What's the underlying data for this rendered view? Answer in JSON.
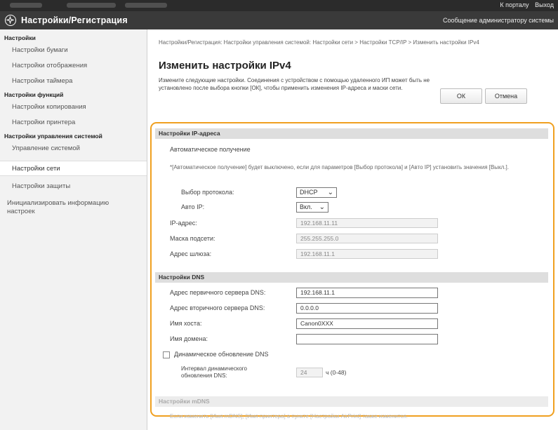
{
  "topbar": {
    "portal_link": "К порталу",
    "logout_link": "Выход"
  },
  "header": {
    "title": "Настройки/Регистрация",
    "message_link": "Сообщение администратору системы"
  },
  "sidebar": {
    "sections": [
      {
        "category": "Настройки",
        "items": [
          "Настройки бумаги",
          "Настройки отображения",
          "Настройки таймера"
        ]
      },
      {
        "category": "Настройки функций",
        "items": [
          "Настройки копирования",
          "Настройки принтера"
        ]
      },
      {
        "category": "Настройки управления системой",
        "items": [
          "Управление системой",
          "Настройки сети",
          "Настройки защиты",
          "Инициализировать информацию настроек"
        ]
      }
    ],
    "active_item": "Настройки сети"
  },
  "main": {
    "breadcrumb": "Настройки/Регистрация: Настройки управления системой: Настройки сети > Настройки TCP/IP > Изменить настройки IPv4",
    "title": "Изменить настройки IPv4",
    "description": "Измените следующие настройки. Соединения с устройством с помощью удаленного ИП может быть не установлено после выбора кнопки [ОК], чтобы применить изменения IP-адреса и маски сети.",
    "ok_button": "ОК",
    "cancel_button": "Отмена"
  },
  "ip_section": {
    "header": "Настройки IP-адреса",
    "auto_label": "Автоматическое получение",
    "note": "*[Автоматическое получение] будет выключено, если для параметров [Выбор протокола] и [Авто IP] установить значения [Выкл.].",
    "protocol_label": "Выбор протокола:",
    "protocol_value": "DHCP",
    "auto_ip_label": "Авто IP:",
    "auto_ip_value": "Вкл.",
    "ip_label": "IP-адрес:",
    "ip_value": "192.168.11.11",
    "mask_label": "Маска подсети:",
    "mask_value": "255.255.255.0",
    "gateway_label": "Адрес шлюза:",
    "gateway_value": "192.168.11.1"
  },
  "dns_section": {
    "header": "Настройки DNS",
    "primary_label": "Адрес первичного сервера DNS:",
    "primary_value": "192.168.11.1",
    "secondary_label": "Адрес вторичного сервера DNS:",
    "secondary_value": "0.0.0.0",
    "host_label": "Имя хоста:",
    "host_value": "Canon0XXX",
    "domain_label": "Имя домена:",
    "domain_value": "",
    "dynamic_label": "Динамическое обновление DNS",
    "dynamic_checked": false,
    "interval_label": "Интервал динамического обновления DNS:",
    "interval_value": "24",
    "interval_hint": "ч (0-48)"
  },
  "mdns_section": {
    "header": "Настройки mDNS",
    "note": "Если изменить [Имя mDNS], [Имя принтера] в пункте [Настройки AirPrint] также изменится."
  },
  "colors": {
    "highlight": "#f0a020",
    "header_bg": "#3a3a3a",
    "topbar_bg": "#2b2b2b"
  }
}
